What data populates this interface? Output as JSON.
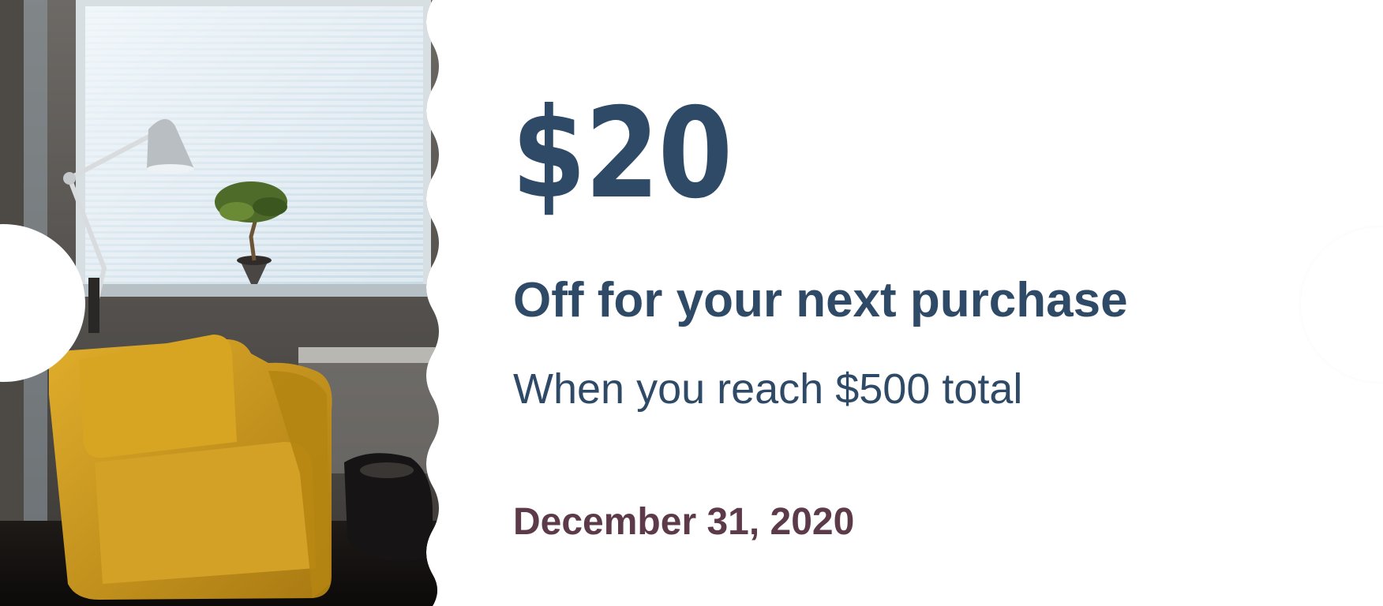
{
  "coupon": {
    "amount": "$20",
    "headline": "Off for your next purchase",
    "condition": "When you reach $500 total",
    "expiry_date": "December 31, 2020"
  },
  "colors": {
    "primary_text": "#2e4a66",
    "date_text": "#5c3a49",
    "background": "#ffffff",
    "armchair": "#d29f1e"
  },
  "photo": {
    "subject": "armchair-window-photo"
  }
}
